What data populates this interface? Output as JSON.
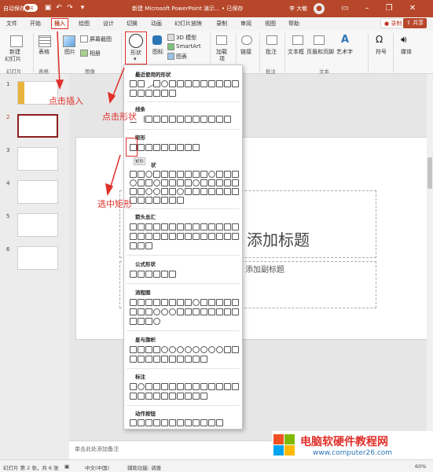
{
  "titlebar": {
    "autosave": "自动保存",
    "toggle_state": "关",
    "title": "新建 Microsoft PowerPoint 演示... • 已保存",
    "user": "李 大敏"
  },
  "tabs": [
    "文件",
    "开始",
    "插入",
    "绘图",
    "设计",
    "切换",
    "动画",
    "幻灯片放映",
    "录制",
    "审阅",
    "视图",
    "帮助"
  ],
  "record_button": "录制",
  "share_button": "共享",
  "ribbon": {
    "new_slide": "新建",
    "new_slide_sub": "幻灯片",
    "table": "表格",
    "image": "图片",
    "screenshot": "屏幕截图",
    "album": "相册",
    "shapes": "形状",
    "icons": "图标",
    "model3d": "3D 模型",
    "smartart": "SmartArt",
    "chart": "图表",
    "addins": "加载",
    "addins_sub": "项",
    "link": "链接",
    "comment": "批注",
    "textbox": "文本框",
    "headerfooter": "页眉和页脚",
    "wordart": "艺术字",
    "symbol": "符号",
    "media": "媒体",
    "groups": {
      "slides": "幻灯片",
      "tables": "表格",
      "images": "图像",
      "comments": "批注",
      "text": "文本"
    }
  },
  "thumbnails": [
    "1",
    "2",
    "3",
    "4",
    "5",
    "6"
  ],
  "slide": {
    "title_placeholder": "添加标题",
    "subtitle_placeholder": "添加副标题"
  },
  "notes_placeholder": "单击此处添加备注",
  "shapes_menu": {
    "recent": "最近使用的形状",
    "lines": "线条",
    "rectangles": "矩形",
    "basic": "基本形状",
    "basic_visible": "状",
    "tooltip": "矩形",
    "arrows": "箭头总汇",
    "equation": "公式形状",
    "flowchart": "流程图",
    "stars": "星与旗帜",
    "callouts": "标注",
    "actions": "动作按钮"
  },
  "annotations": {
    "click_insert": "点击插入",
    "click_shape": "点击形状",
    "select_rect": "选中矩形"
  },
  "status": {
    "slide_count": "幻灯片 第 2 张，共 6 张",
    "language": "中文(中国)",
    "accessibility": "辅助功能: 调查",
    "zoom": "60%"
  },
  "watermark": {
    "name": "电脑软硬件教程网",
    "url": "www.computer26.com"
  },
  "colors": {
    "accent": "#b7472a",
    "highlight": "#e0302a"
  }
}
